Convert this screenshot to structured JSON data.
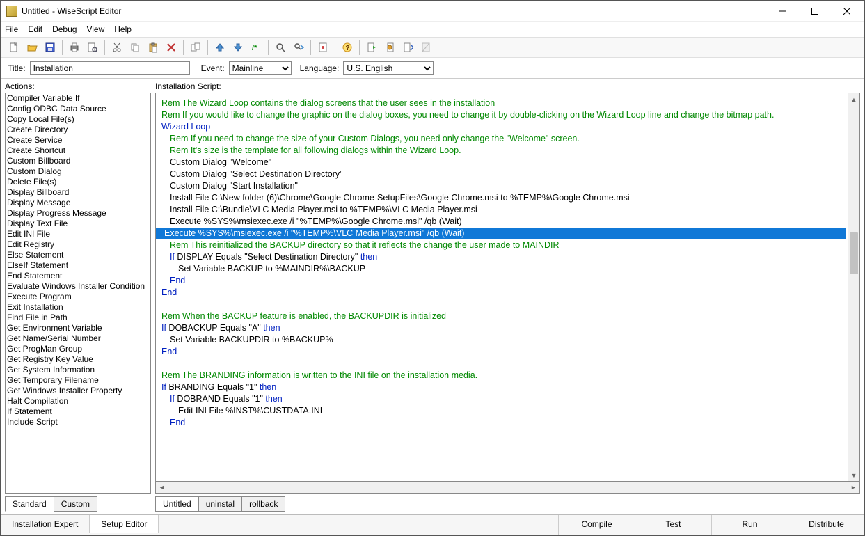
{
  "window": {
    "title": "Untitled - WiseScript Editor"
  },
  "menubar": [
    "File",
    "Edit",
    "Debug",
    "View",
    "Help"
  ],
  "toolbar_icons": [
    "new",
    "open",
    "save",
    "sep",
    "print",
    "print-preview",
    "sep",
    "cut",
    "copy",
    "paste",
    "delete",
    "sep",
    "duplicate",
    "sep",
    "move-up",
    "move-down",
    "comment",
    "sep",
    "find",
    "find-next",
    "sep",
    "properties",
    "sep",
    "help",
    "sep",
    "script-in",
    "script-out",
    "script-cancel",
    "script-disabled"
  ],
  "controls": {
    "title_label": "Title:",
    "title_value": "Installation",
    "event_label": "Event:",
    "event_value": "Mainline",
    "language_label": "Language:",
    "language_value": "U.S. English"
  },
  "left": {
    "label": "Actions:",
    "items": [
      "Compiler Variable If",
      "Config ODBC Data Source",
      "Copy Local File(s)",
      "Create Directory",
      "Create Service",
      "Create Shortcut",
      "Custom Billboard",
      "Custom Dialog",
      "Delete File(s)",
      "Display Billboard",
      "Display Message",
      "Display Progress Message",
      "Display Text File",
      "Edit INI File",
      "Edit Registry",
      "Else Statement",
      "ElseIf Statement",
      "End Statement",
      "Evaluate Windows Installer Condition",
      "Execute Program",
      "Exit Installation",
      "Find File in Path",
      "Get Environment Variable",
      "Get Name/Serial Number",
      "Get ProgMan Group",
      "Get Registry Key Value",
      "Get System Information",
      "Get Temporary Filename",
      "Get Windows Installer Property",
      "Halt Compilation",
      "If Statement",
      "Include Script"
    ],
    "tabs": [
      "Standard",
      "Custom"
    ],
    "active_tab": "Standard"
  },
  "right": {
    "label": "Installation Script:",
    "script": [
      {
        "indent": 0,
        "type": "rem",
        "text": "Rem The Wizard Loop contains the dialog screens that the user sees in the installation"
      },
      {
        "indent": 0,
        "type": "rem",
        "text": "Rem If you would like to change the graphic on the dialog boxes, you need to change it by double-clicking on the Wizard Loop line and change the bitmap path."
      },
      {
        "indent": 0,
        "type": "kw",
        "text": "Wizard Loop"
      },
      {
        "indent": 1,
        "type": "rem",
        "text": "Rem If you need to change the size of your Custom Dialogs, you need only change the \"Welcome\" screen."
      },
      {
        "indent": 1,
        "type": "rem",
        "text": "Rem It's size is the template for all following dialogs within the Wizard Loop."
      },
      {
        "indent": 1,
        "type": "txt",
        "text": "Custom Dialog \"Welcome\""
      },
      {
        "indent": 1,
        "type": "txt",
        "text": "Custom Dialog \"Select Destination Directory\""
      },
      {
        "indent": 1,
        "type": "txt",
        "text": "Custom Dialog \"Start Installation\""
      },
      {
        "indent": 1,
        "type": "txt",
        "text": "Install File C:\\New folder (6)\\Chrome\\Google Chrome-SetupFiles\\Google Chrome.msi to %TEMP%\\Google Chrome.msi"
      },
      {
        "indent": 1,
        "type": "txt",
        "text": "Install File C:\\Bundle\\VLC Media Player.msi to %TEMP%\\VLC Media Player.msi"
      },
      {
        "indent": 1,
        "type": "txt",
        "text": "Execute %SYS%\\msiexec.exe /i \"%TEMP%\\Google Chrome.msi\" /qb (Wait)"
      },
      {
        "indent": 1,
        "type": "txt",
        "text": "Execute %SYS%\\msiexec.exe /i \"%TEMP%\\VLC Media Player.msi\" /qb (Wait)",
        "selected": true
      },
      {
        "indent": 1,
        "type": "rem",
        "text": "Rem This reinitialized the BACKUP directory so that it reflects the change the user made to MAINDIR"
      },
      {
        "indent": 1,
        "type": "if",
        "pre": "If ",
        "cond": "DISPLAY Equals \"Select Destination Directory\" ",
        "post": "then"
      },
      {
        "indent": 2,
        "type": "txt",
        "text": "Set Variable BACKUP to %MAINDIR%\\BACKUP"
      },
      {
        "indent": 1,
        "type": "kw",
        "text": "End"
      },
      {
        "indent": 0,
        "type": "kw",
        "text": "End"
      },
      {
        "indent": 0,
        "type": "blank",
        "text": ""
      },
      {
        "indent": 0,
        "type": "rem",
        "text": "Rem When the BACKUP feature is enabled, the BACKUPDIR is initialized"
      },
      {
        "indent": 0,
        "type": "if",
        "pre": "If ",
        "cond": "DOBACKUP Equals \"A\" ",
        "post": "then"
      },
      {
        "indent": 1,
        "type": "txt",
        "text": "Set Variable BACKUPDIR to %BACKUP%"
      },
      {
        "indent": 0,
        "type": "kw",
        "text": "End"
      },
      {
        "indent": 0,
        "type": "blank",
        "text": ""
      },
      {
        "indent": 0,
        "type": "rem",
        "text": "Rem The BRANDING information is written to the INI file on the installation media."
      },
      {
        "indent": 0,
        "type": "if",
        "pre": "If ",
        "cond": "BRANDING Equals \"1\" ",
        "post": "then"
      },
      {
        "indent": 1,
        "type": "if",
        "pre": "If ",
        "cond": "DOBRAND Equals \"1\" ",
        "post": "then"
      },
      {
        "indent": 2,
        "type": "txt",
        "text": "Edit INI File %INST%\\CUSTDATA.INI"
      },
      {
        "indent": 1,
        "type": "kw",
        "text": "End"
      }
    ],
    "tabs": [
      "Untitled",
      "uninstal",
      "rollback"
    ],
    "active_tab": "Untitled"
  },
  "footer": {
    "left_tabs": [
      "Installation Expert",
      "Setup Editor"
    ],
    "active_left": "Setup Editor",
    "right_btns": [
      "Compile",
      "Test",
      "Run",
      "Distribute"
    ]
  }
}
